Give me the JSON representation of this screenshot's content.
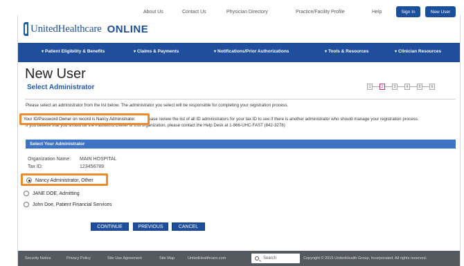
{
  "header": {
    "brand": "UnitedHealthcare",
    "online": "ONLINE",
    "links": [
      "About Us",
      "Contact Us",
      "Physician Directory",
      "Practice/Facility Profile",
      "Help"
    ],
    "sign_in": "Sign In",
    "new_user": "New User"
  },
  "nav": {
    "items": [
      "Patient Eligibility & Benefits",
      "Claims & Payments",
      "Notifications/Prior Authorizations",
      "Tools & Resources",
      "Clinician Resources"
    ]
  },
  "page": {
    "title": "New User",
    "subtitle": "Select Administrator",
    "steps": [
      "1",
      "2",
      "3",
      "4",
      "5",
      "6"
    ],
    "active_step": 2,
    "intro": "Please select an administrator from the list below. The administrator you select will be responsible for completing your registration process.",
    "info_line1_rest": "lease review the list of all ID administrators for your tax ID to see if there is another administrator who should manage your registration process.",
    "info_line2": "If you believe that you should be the Password Owner of this organization, please contact the Help Desk at 1-866-UHC-FAST (842-3278)",
    "callout_text": "Your ID/Password Owner on record is Nancy Administrator."
  },
  "panel": {
    "heading": "Select Your Administrator",
    "org_label": "Organization Name:",
    "org_value": "MAIN HOSPITAL",
    "tax_label": "Tax ID:",
    "tax_value": "123456789",
    "options": [
      {
        "label": "Nancy Administrator, Other",
        "selected": true
      },
      {
        "label": "JANE DOE, Admitting",
        "selected": false
      },
      {
        "label": "John Doe, Patient Financial Services",
        "selected": false
      }
    ]
  },
  "actions": {
    "continue": "CONTINUE",
    "previous": "PREVIOUS",
    "cancel": "CANCEL"
  },
  "footer": {
    "links": [
      "Security Notice",
      "Privacy Policy",
      "Site Use Agreement",
      "Site Map",
      "UnitedHealthcare.com"
    ],
    "search_placeholder": "Search",
    "copyright": "Copyright © 2015 UnitedHealth Group, Incorporated. All rights reserved."
  },
  "colors": {
    "brand_blue": "#1f4f9c",
    "panel_blue": "#3f73c4",
    "callout_orange": "#ef8a2a",
    "active_step": "#c62a74",
    "footer_gray": "#555a60"
  }
}
